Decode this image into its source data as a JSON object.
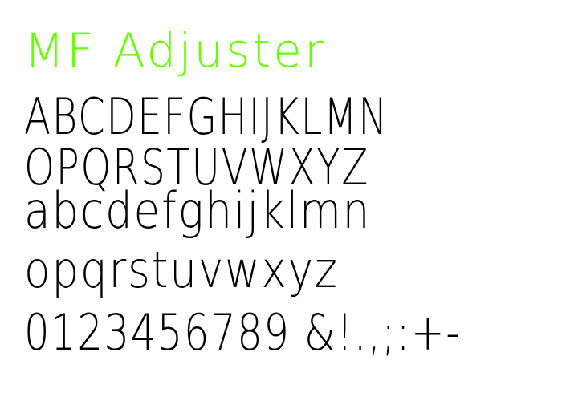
{
  "colors": {
    "title": "#66ff00",
    "text": "#000000",
    "background": "#ffffff"
  },
  "specimen": {
    "title": "MF Adjuster",
    "uppercase_line1": "ABCDEFGHIJKLMN",
    "uppercase_line2": "OPQRSTUVWXYZ",
    "lowercase_line1": "abcdefghijklmn",
    "lowercase_line2": "opqrstuvwxyz",
    "digits_symbols": "0123456789 &!.,;:+-"
  }
}
